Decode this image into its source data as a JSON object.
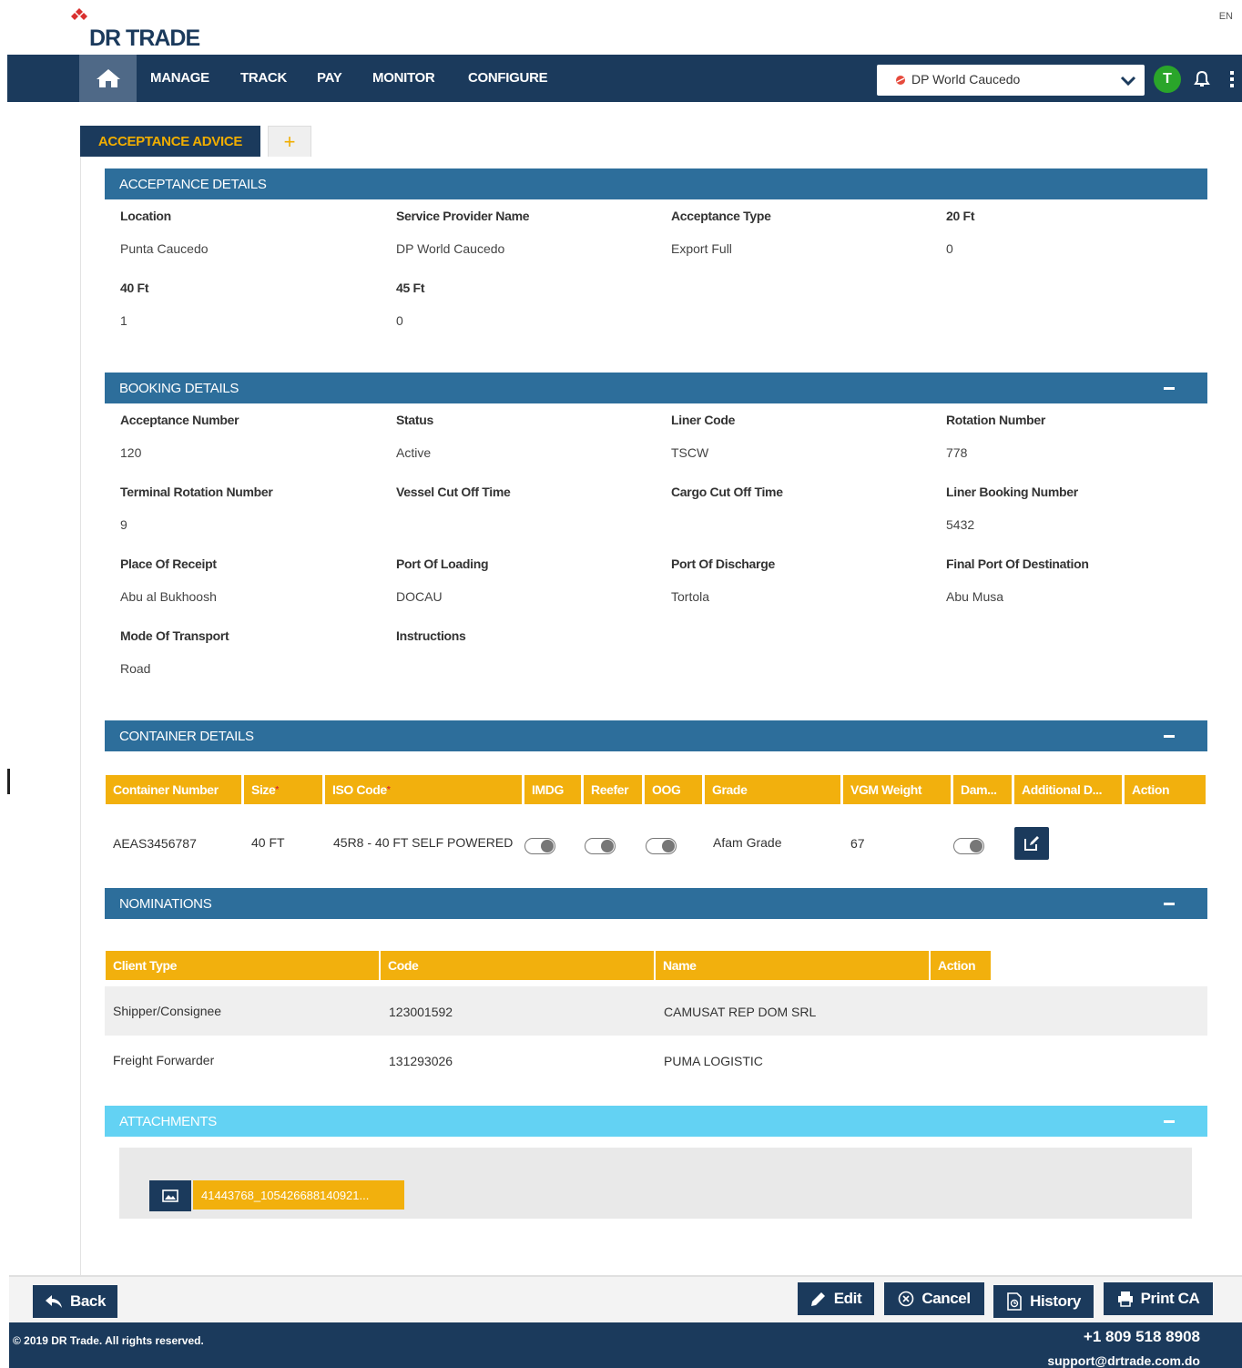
{
  "brand": {
    "logo_text": "DR TRADE",
    "accent": "#f2b00d",
    "primary": "#1b3a5c",
    "section": "#2d6e9b"
  },
  "header": {
    "language": "EN",
    "nav": [
      "MANAGE",
      "TRACK",
      "PAY",
      "MONITOR",
      "CONFIGURE"
    ],
    "port_selector": {
      "value": "DP World Caucedo"
    },
    "avatar_initial": "T"
  },
  "tabs": {
    "active": "ACCEPTANCE ADVICE",
    "add": "+"
  },
  "acceptance": {
    "title": "ACCEPTANCE DETAILS",
    "fields": [
      {
        "label": "Location",
        "value": "Punta Caucedo"
      },
      {
        "label": "Service Provider Name",
        "value": "DP World Caucedo"
      },
      {
        "label": "Acceptance Type",
        "value": "Export Full"
      },
      {
        "label": "20 Ft",
        "value": "0"
      },
      {
        "label": "40 Ft",
        "value": "1"
      },
      {
        "label": "45 Ft",
        "value": "0"
      }
    ]
  },
  "booking": {
    "title": "BOOKING DETAILS",
    "fields": [
      {
        "label": "Acceptance Number",
        "value": "120"
      },
      {
        "label": "Status",
        "value": "Active"
      },
      {
        "label": "Liner Code",
        "value": "TSCW"
      },
      {
        "label": "Rotation Number",
        "value": "778"
      },
      {
        "label": "Terminal Rotation Number",
        "value": "9"
      },
      {
        "label": "Vessel Cut Off Time",
        "value": ""
      },
      {
        "label": "Cargo Cut Off Time",
        "value": ""
      },
      {
        "label": "Liner Booking Number",
        "value": "5432"
      },
      {
        "label": "Place Of Receipt",
        "value": "Abu al Bukhoosh"
      },
      {
        "label": "Port Of Loading",
        "value": "DOCAU"
      },
      {
        "label": "Port Of Discharge",
        "value": "Tortola"
      },
      {
        "label": "Final Port Of Destination",
        "value": "Abu Musa"
      },
      {
        "label": "Mode Of Transport",
        "value": "Road"
      },
      {
        "label": "Instructions",
        "value": ""
      }
    ]
  },
  "containers": {
    "title": "CONTAINER DETAILS",
    "columns": [
      "Container Number",
      "Size",
      "ISO Code",
      "IMDG",
      "Reefer",
      "OOG",
      "Grade",
      "VGM Weight",
      "Dam...",
      "Additional D...",
      "Action"
    ],
    "required_mark": "*",
    "rows": [
      {
        "number": "AEAS3456787",
        "size": "40 FT",
        "iso": "45R8 - 40 FT SELF POWERED",
        "imdg": false,
        "reefer": false,
        "oog": false,
        "grade": "Afam Grade",
        "vgm": "67",
        "damage": false
      }
    ]
  },
  "nominations": {
    "title": "NOMINATIONS",
    "columns": [
      "Client Type",
      "Code",
      "Name",
      "Action"
    ],
    "rows": [
      {
        "type": "Shipper/Consignee",
        "code": "123001592",
        "name": "CAMUSAT REP DOM SRL"
      },
      {
        "type": "Freight Forwarder",
        "code": "131293026",
        "name": "PUMA LOGISTIC"
      }
    ]
  },
  "attachments": {
    "title": "ATTACHMENTS",
    "files": [
      {
        "name": "41443768_105426688140921..."
      }
    ]
  },
  "actions": {
    "back": "Back",
    "edit": "Edit",
    "cancel": "Cancel",
    "history": "History",
    "print": "Print CA"
  },
  "footer": {
    "copyright": "© 2019 DR Trade. All rights reserved.",
    "phone": "+1 809 518 8908",
    "email": "support@drtrade.com.do"
  }
}
